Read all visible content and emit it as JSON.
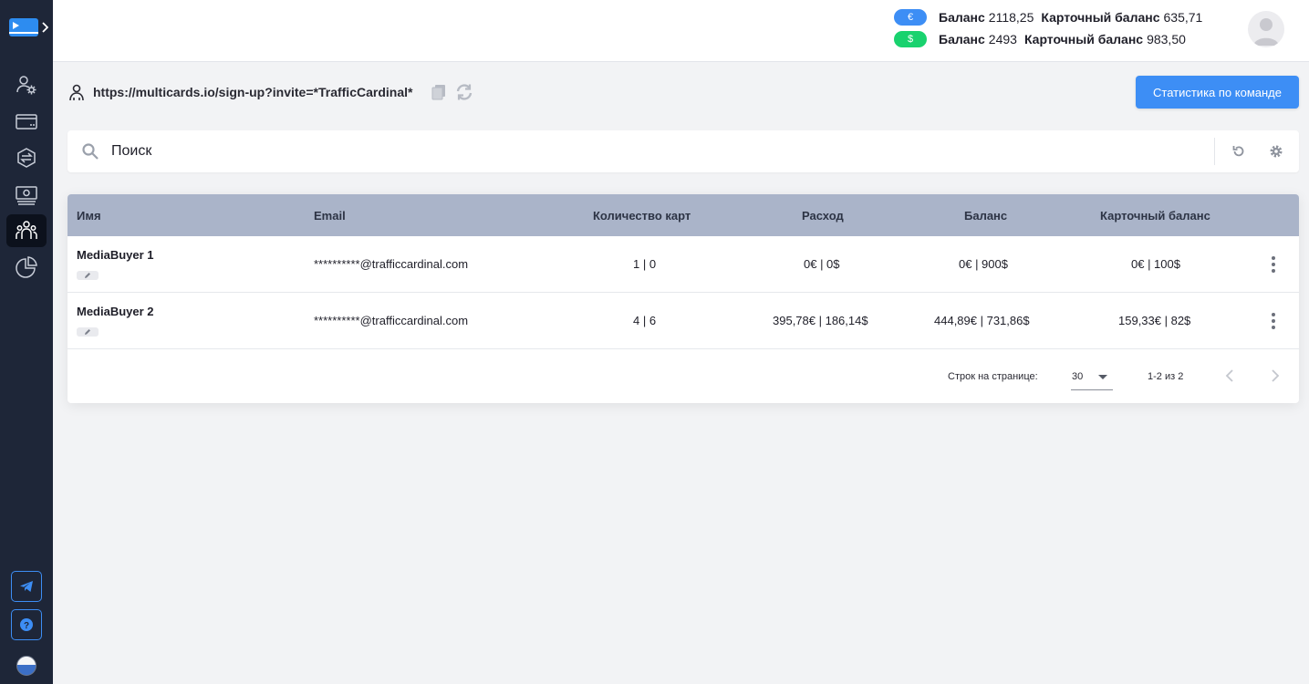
{
  "sidebar": {
    "nav": [
      {
        "icon": "settings-users-icon"
      },
      {
        "icon": "credit-card-icon"
      },
      {
        "icon": "exchange-icon"
      },
      {
        "icon": "cash-icon"
      },
      {
        "icon": "team-icon",
        "active": true
      },
      {
        "icon": "pie-chart-icon"
      }
    ],
    "bottom": [
      {
        "icon": "telegram-icon"
      },
      {
        "icon": "help-icon"
      }
    ]
  },
  "header": {
    "balances": [
      {
        "currency_symbol": "€",
        "balance_label": "Баланс",
        "balance_value": "2118,25",
        "card_label": "Карточный баланс",
        "card_value": "635,71",
        "color": "#3d8ef5"
      },
      {
        "currency_symbol": "$",
        "balance_label": "Баланс",
        "balance_value": "2493",
        "card_label": "Карточный баланс",
        "card_value": "983,50",
        "color": "#19d26e"
      }
    ]
  },
  "invite": {
    "url": "https://multicards.io/sign-up?invite=*TrafficCardinal*"
  },
  "team_stats_button": "Статистика по команде",
  "search": {
    "placeholder": "Поиск"
  },
  "table": {
    "columns": [
      "Имя",
      "Email",
      "Количество карт",
      "Расход",
      "Баланс",
      "Карточный баланс"
    ],
    "rows": [
      {
        "name": "MediaBuyer 1",
        "email": "**********@trafficcardinal.com",
        "cards": "1 | 0",
        "spend": "0€ | 0$",
        "balance": "0€ | 900$",
        "card_balance": "0€ | 100$"
      },
      {
        "name": "MediaBuyer 2",
        "email": "**********@trafficcardinal.com",
        "cards": "4 | 6",
        "spend": "395,78€ | 186,14$",
        "balance": "444,89€ | 731,86$",
        "card_balance": "159,33€ | 82$"
      }
    ]
  },
  "pagination": {
    "rows_per_page_label": "Строк на странице:",
    "rows_per_page": "30",
    "range": "1-2 из 2"
  }
}
